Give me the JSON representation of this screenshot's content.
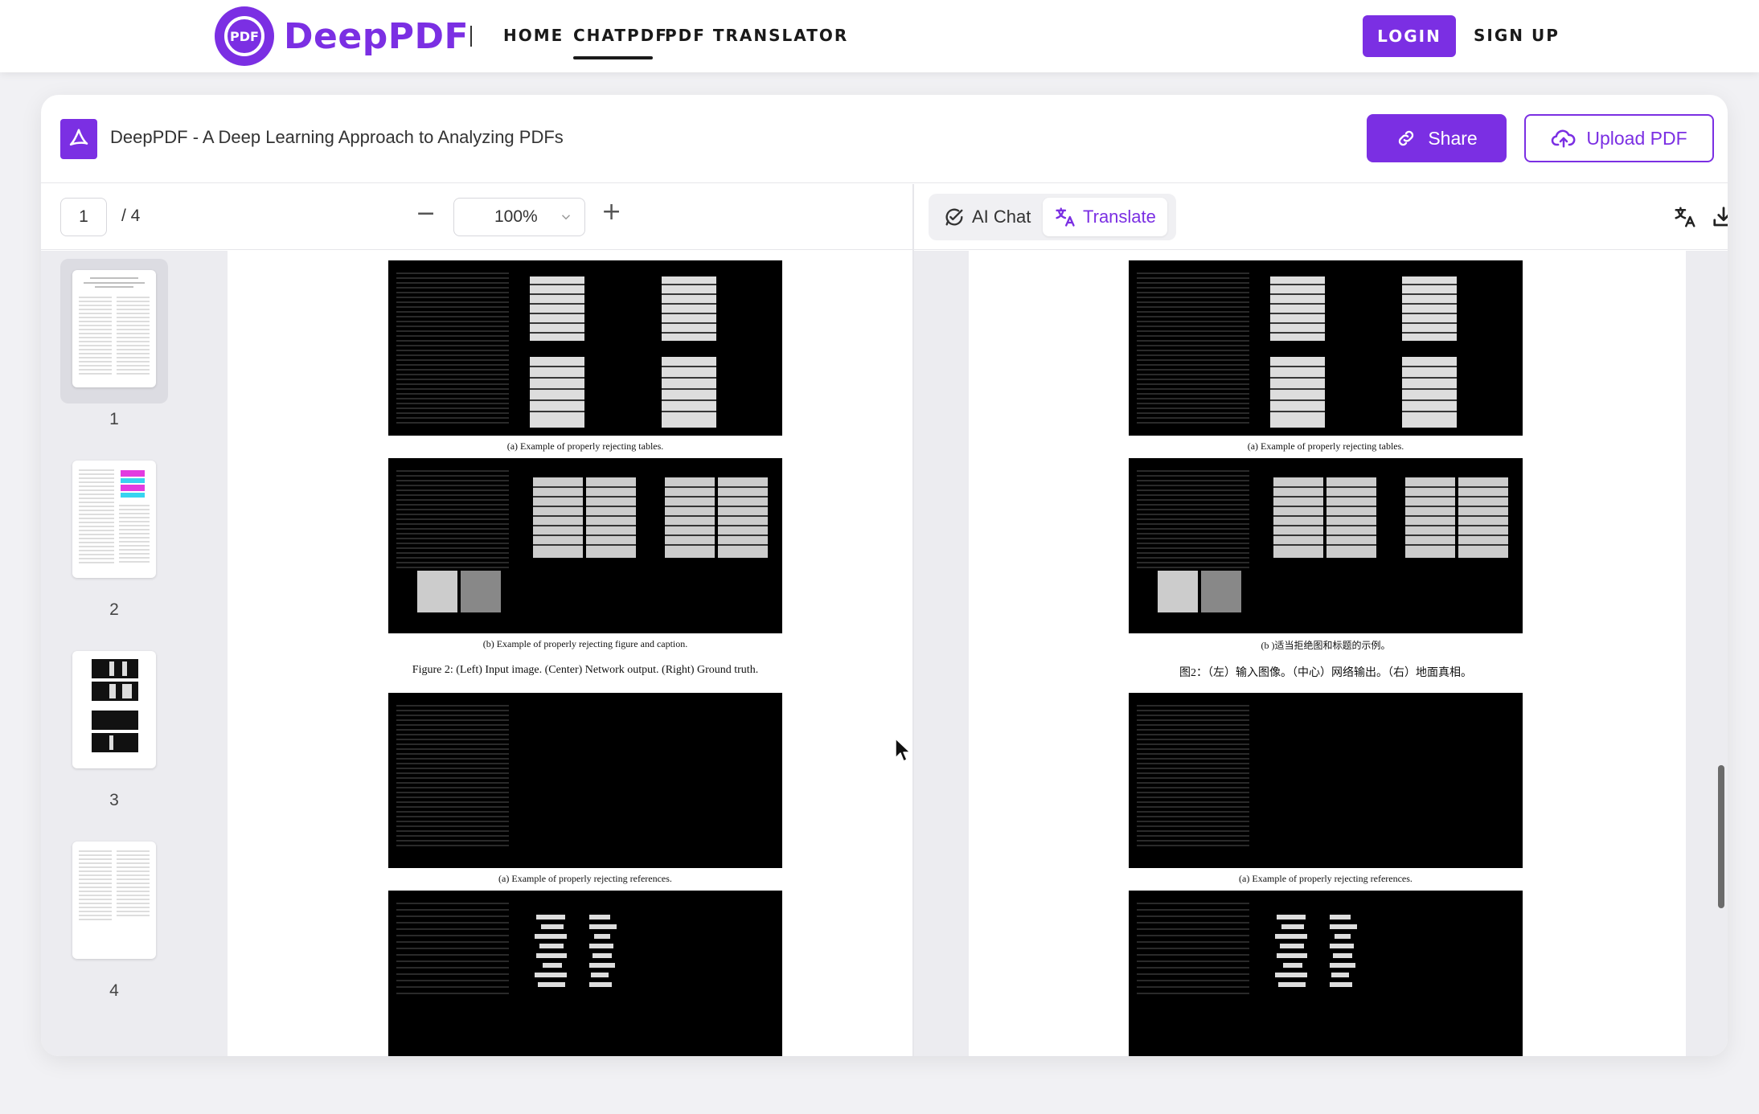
{
  "nav": {
    "logo_mark": "PDF",
    "logo_text": "DeepPDF",
    "links": [
      "HOME",
      "CHATPDF",
      "PDF TRANSLATOR"
    ],
    "active": "CHATPDF",
    "login": "LOGIN",
    "signup": "SIGN UP"
  },
  "document": {
    "title": "DeepPDF - A Deep Learning Approach to Analyzing PDFs",
    "share_label": "Share",
    "upload_label": "Upload PDF"
  },
  "toolbar": {
    "page_current": "1",
    "page_total": "/  4",
    "zoom": "100%",
    "zoom_out_icon": "minus-icon",
    "zoom_in_icon": "plus-icon"
  },
  "right_toolbar": {
    "tabs": [
      "AI Chat",
      "Translate"
    ],
    "active_tab": "Translate",
    "icons": [
      "translate-icon",
      "download-icon"
    ]
  },
  "thumbnails": [
    {
      "label": "1",
      "active": true
    },
    {
      "label": "2",
      "active": false
    },
    {
      "label": "3",
      "active": false
    },
    {
      "label": "4",
      "active": false
    }
  ],
  "left_page": {
    "captions": {
      "a": "(a) Example of properly rejecting tables.",
      "b": "(b) Example of properly rejecting figure and caption.",
      "figure2": "Figure 2: (Left) Input image. (Center) Network output. (Right) Ground truth.",
      "c": "(a) Example of properly rejecting references."
    }
  },
  "right_page": {
    "captions": {
      "a": "(a) Example of properly rejecting tables.",
      "b": "(b )适当拒绝图和标题的示例。",
      "figure2": "图2：（左）输入图像。（中心）网络输出。（右）地面真相。",
      "c": "(a) Example of properly rejecting references."
    }
  },
  "colors": {
    "brand": "#7b2fe3",
    "panel_bg": "#ececf0",
    "page_bg": "#f1f1f4"
  }
}
